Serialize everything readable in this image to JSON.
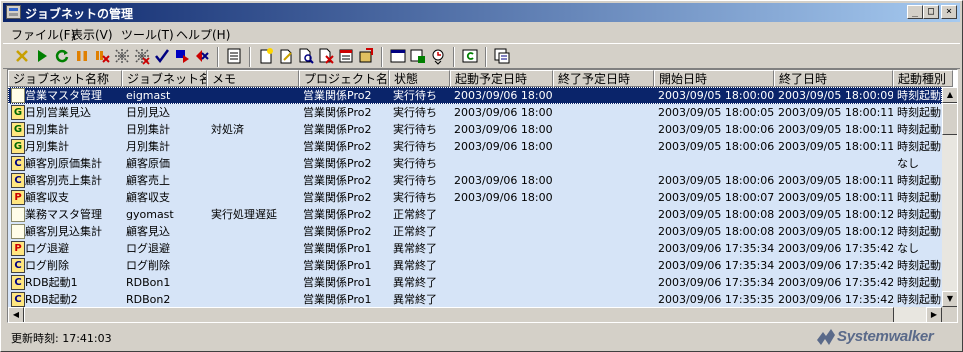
{
  "window": {
    "title": "ジョブネットの管理",
    "controls": {
      "minimize": "_",
      "maximize": "□",
      "close": "×"
    }
  },
  "menu": [
    "ファイル(F)",
    "表示(V)",
    "ツール(T)",
    "ヘルプ(H)"
  ],
  "toolbar": {
    "icons": [
      "cut-icon",
      "start-icon",
      "restart-icon",
      "pause-icon",
      "cancel-icon",
      "disable-icon",
      "enable-icon",
      "confirm-icon",
      "flag-icon",
      "delete-schedule-icon",
      "list-icon",
      "new-icon",
      "edit-icon",
      "search-icon",
      "delete-icon",
      "calendar-icon",
      "export-icon",
      "window-icon",
      "properties-icon",
      "history-icon",
      "refresh-icon",
      "info-icon"
    ]
  },
  "table": {
    "columns": [
      "ジョブネット名称",
      "ジョブネット名",
      "メモ",
      "プロジェクト名",
      "状態",
      "起動予定日時",
      "終了予定日時",
      "開始日時",
      "終了日時",
      "起動種別"
    ],
    "rows": [
      {
        "icon": "doc",
        "selected": true,
        "cells": [
          "営業マスタ管理",
          "eigmast",
          "",
          "営業関係Pro2",
          "実行待ち",
          "2003/09/06 18:00",
          "",
          "2003/09/05 18:00:00",
          "2003/09/05 18:00:09",
          "時刻起動"
        ]
      },
      {
        "icon": "G",
        "cells": [
          "日別営業見込",
          "日別見込",
          "",
          "営業関係Pro2",
          "実行待ち",
          "2003/09/06 18:00",
          "",
          "2003/09/05 18:00:05",
          "2003/09/05 18:00:11",
          "時刻起動"
        ]
      },
      {
        "icon": "G",
        "cells": [
          "日別集計",
          "日別集計",
          "対処済",
          "営業関係Pro2",
          "実行待ち",
          "2003/09/06 18:00",
          "",
          "2003/09/05 18:00:06",
          "2003/09/05 18:00:11",
          "時刻起動"
        ]
      },
      {
        "icon": "G",
        "cells": [
          "月別集計",
          "月別集計",
          "",
          "営業関係Pro2",
          "実行待ち",
          "2003/09/06 18:00",
          "",
          "2003/09/05 18:00:06",
          "2003/09/05 18:00:11",
          "時刻起動"
        ]
      },
      {
        "icon": "C",
        "cells": [
          "顧客別原価集計",
          "顧客原価",
          "",
          "営業関係Pro2",
          "実行待ち",
          "",
          "",
          "",
          "",
          "なし"
        ]
      },
      {
        "icon": "C",
        "cells": [
          "顧客別売上集計",
          "顧客売上",
          "",
          "営業関係Pro2",
          "実行待ち",
          "2003/09/06 18:00",
          "",
          "2003/09/05 18:00:06",
          "2003/09/05 18:00:11",
          "時刻起動"
        ]
      },
      {
        "icon": "P",
        "cells": [
          "顧客収支",
          "顧客収支",
          "",
          "営業関係Pro2",
          "実行待ち",
          "2003/09/06 18:00",
          "",
          "2003/09/05 18:00:07",
          "2003/09/05 18:00:11",
          "時刻起動"
        ]
      },
      {
        "icon": "doc",
        "cells": [
          "業務マスタ管理",
          "gyomast",
          "実行処理遅延",
          "営業関係Pro2",
          "正常終了",
          "",
          "",
          "2003/09/05 18:00:08",
          "2003/09/05 18:00:12",
          "時刻起動"
        ]
      },
      {
        "icon": "doc",
        "cells": [
          "顧客別見込集計",
          "顧客見込",
          "",
          "営業関係Pro2",
          "正常終了",
          "",
          "",
          "2003/09/05 18:00:08",
          "2003/09/05 18:00:12",
          "時刻起動"
        ]
      },
      {
        "icon": "P",
        "cells": [
          "ログ退避",
          "ログ退避",
          "",
          "営業関係Pro1",
          "異常終了",
          "",
          "",
          "2003/09/06 17:35:34",
          "2003/09/06 17:35:42",
          "なし"
        ]
      },
      {
        "icon": "C",
        "cells": [
          "ログ削除",
          "ログ削除",
          "",
          "営業関係Pro1",
          "異常終了",
          "",
          "",
          "2003/09/06 17:35:34",
          "2003/09/06 17:35:42",
          "時刻起動"
        ]
      },
      {
        "icon": "C",
        "cells": [
          "RDB起動1",
          "RDBon1",
          "",
          "営業関係Pro1",
          "異常終了",
          "",
          "",
          "2003/09/06 17:35:34",
          "2003/09/06 17:35:42",
          "時刻起動"
        ]
      },
      {
        "icon": "C",
        "cells": [
          "RDB起動2",
          "RDBon2",
          "",
          "営業関係Pro1",
          "異常終了",
          "",
          "",
          "2003/09/06 17:35:35",
          "2003/09/06 17:35:42",
          "時刻起動"
        ]
      }
    ]
  },
  "status": {
    "text": "更新時刻:  17:41:03"
  },
  "brand": {
    "name": "Systemwalker"
  }
}
